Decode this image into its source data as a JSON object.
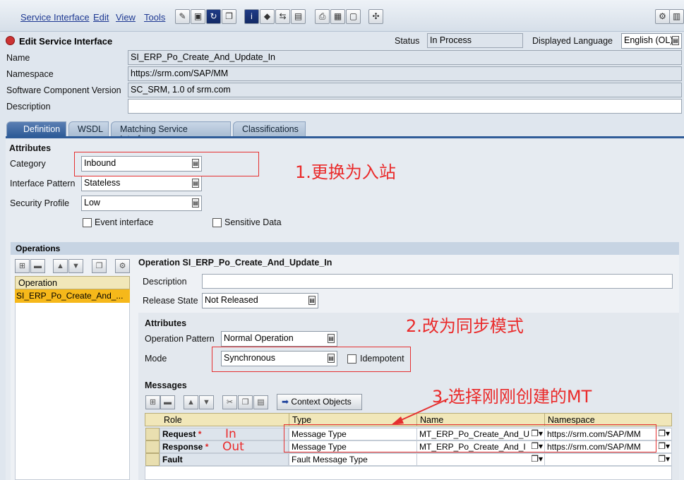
{
  "menu": [
    "Service Interface",
    "Edit",
    "View",
    "Tools"
  ],
  "toolbar_icons": [
    "pencil-icon",
    "save-icon",
    "refresh-icon",
    "copy-icon",
    "info-icon",
    "eraser-icon",
    "where-used-icon",
    "compare-icon",
    "print-icon",
    "table-icon",
    "document-icon",
    "network-icon",
    "settings-icon"
  ],
  "header": {
    "title": "Edit Service Interface",
    "status_label": "Status",
    "status_value": "In Process",
    "lang_label": "Displayed Language",
    "lang_value": "English (OL)"
  },
  "fields": {
    "name_label": "Name",
    "name_value": "SI_ERP_Po_Create_And_Update_In",
    "ns_label": "Namespace",
    "ns_value": "https://srm.com/SAP/MM",
    "swc_label": "Software Component Version",
    "swc_value": "SC_SRM, 1.0 of srm.com",
    "desc_label": "Description",
    "desc_value": ""
  },
  "tabs": [
    "Definition",
    "WSDL",
    "Matching Service Interfaces",
    "Classifications"
  ],
  "attributes": {
    "title": "Attributes",
    "category_label": "Category",
    "category_value": "Inbound",
    "pattern_label": "Interface Pattern",
    "pattern_value": "Stateless",
    "security_label": "Security Profile",
    "security_value": "Low",
    "event_label": "Event interface",
    "sensitive_label": "Sensitive Data"
  },
  "operations": {
    "title": "Operations",
    "col_header": "Operation",
    "row": "SI_ERP_Po_Create_And_...",
    "detail_title": "Operation SI_ERP_Po_Create_And_Update_In",
    "desc_label": "Description",
    "release_label": "Release State",
    "release_value": "Not Released",
    "attr_title": "Attributes",
    "op_pattern_label": "Operation Pattern",
    "op_pattern_value": "Normal Operation",
    "mode_label": "Mode",
    "mode_value": "Synchronous",
    "idempotent_label": "Idempotent"
  },
  "messages": {
    "title": "Messages",
    "context_btn": "Context Objects",
    "headers": [
      "Role",
      "Type",
      "Name",
      "Namespace"
    ],
    "rows": [
      {
        "role": "Request",
        "req": "*",
        "type": "Message Type",
        "name": "MT_ERP_Po_Create_And_U",
        "ns": "https://srm.com/SAP/MM"
      },
      {
        "role": "Response",
        "req": "*",
        "type": "Message Type",
        "name": "MT_ERP_Po_Create_And_I",
        "ns": "https://srm.com/SAP/MM"
      },
      {
        "role": "Fault",
        "req": "",
        "type": "Fault Message Type",
        "name": "",
        "ns": ""
      }
    ]
  },
  "annotations": {
    "note1": "1.更换为入站",
    "note2": "2.改为同步模式",
    "note3": "3.选择刚刚创建的MT",
    "in": "In",
    "out": "Out"
  },
  "colors": {
    "annotation": "#ea2a2a",
    "tab_active": "#2f5c98",
    "grid_header": "#f1e7b9"
  }
}
